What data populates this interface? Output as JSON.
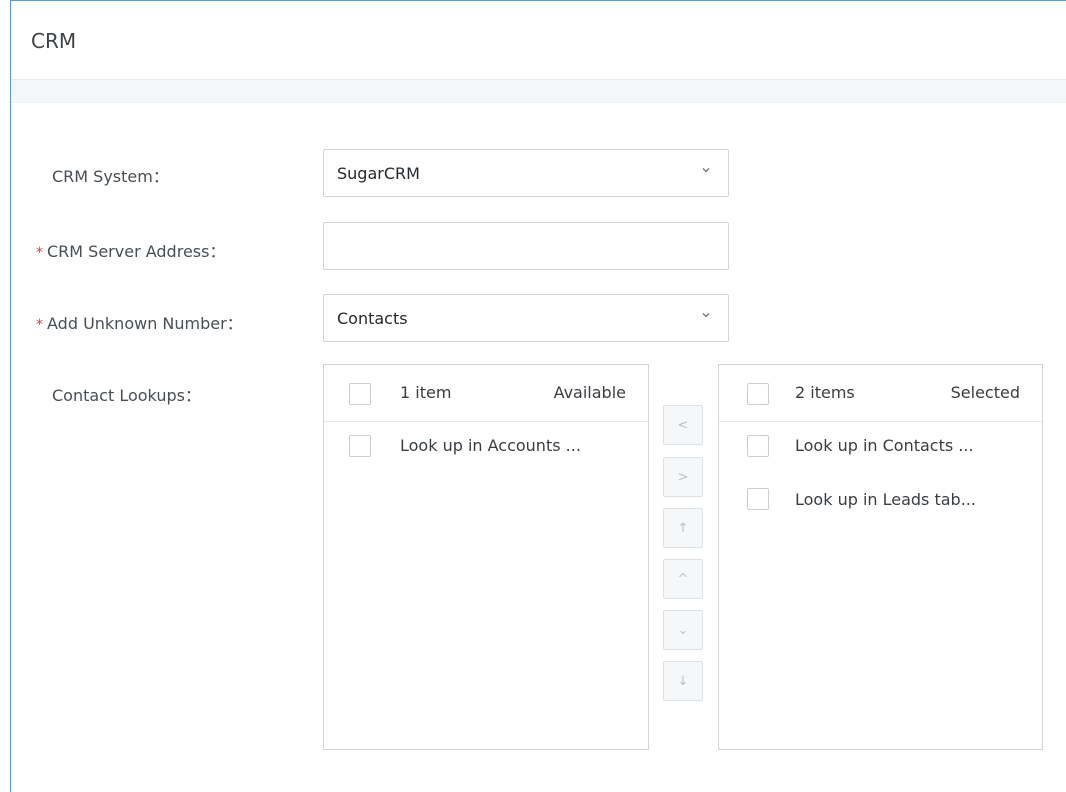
{
  "header": {
    "title": "CRM"
  },
  "form": {
    "crm_system": {
      "label": "CRM System：",
      "value": "SugarCRM"
    },
    "server_address": {
      "required_mark": "*",
      "label": "CRM Server Address：",
      "value": ""
    },
    "unknown_number": {
      "required_mark": "*",
      "label": "Add Unknown Number：",
      "value": "Contacts"
    },
    "contact_lookups": {
      "label": "Contact Lookups："
    }
  },
  "transfer": {
    "available": {
      "count": "1 item",
      "title": "Available",
      "items": [
        "Look up in Accounts ..."
      ]
    },
    "selected": {
      "count": "2 items",
      "title": "Selected",
      "items": [
        "Look up in Contacts ...",
        "Look up in Leads tab..."
      ]
    },
    "buttons": {
      "move_left": "<",
      "move_right": ">",
      "move_top": "↑",
      "move_up": "^",
      "move_down": "⌄",
      "move_bottom": "↓"
    }
  },
  "icons": {
    "dropdown": "chevron-down-icon"
  }
}
